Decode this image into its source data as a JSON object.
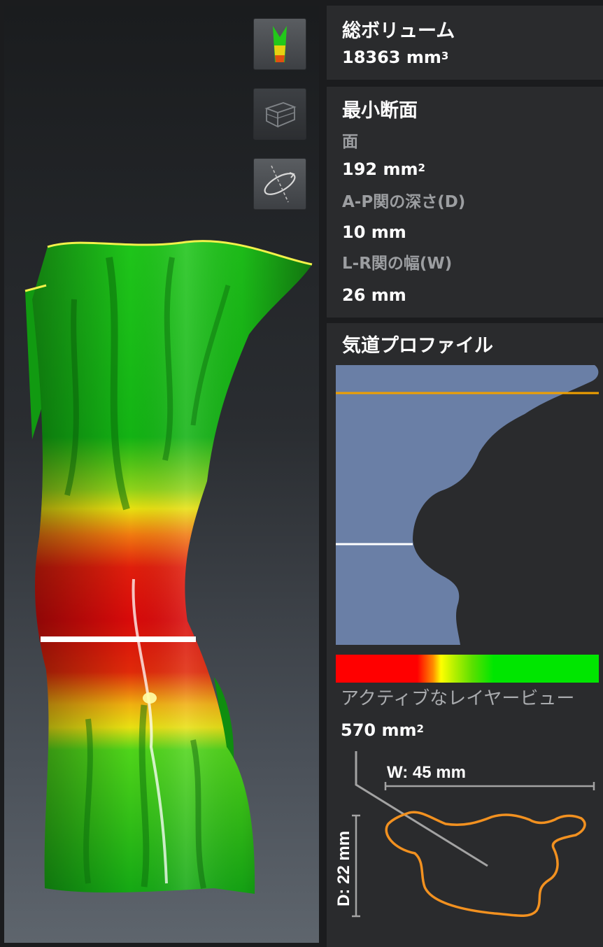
{
  "volume_panel": {
    "title": "総ボリューム",
    "value": "18363 mm",
    "unit_sup": "3"
  },
  "min_section_panel": {
    "title": "最小断面",
    "area_label": "面",
    "area_value": "192 mm",
    "area_sup": "2",
    "depth_label": "A-P関の深さ(D)",
    "depth_value": "10 mm",
    "width_label": "L-R関の幅(W)",
    "width_value": "26 mm"
  },
  "profile_panel": {
    "title": "気道プロファイル",
    "active_layer_label": "アクティブなレイヤービュー",
    "active_layer_value": "570 mm",
    "active_layer_sup": "2",
    "width_dim": "W: 45 mm",
    "depth_dim": "D: 22 mm"
  },
  "colors": {
    "panel_bg": "#2a2b2d",
    "profile_fill": "#6a7fa6",
    "active_line": "#f0a000",
    "min_line": "#ffffff",
    "outline": "#f29120"
  },
  "icons": [
    "airway-color-icon",
    "box-view-icon",
    "rotate-plane-icon"
  ]
}
